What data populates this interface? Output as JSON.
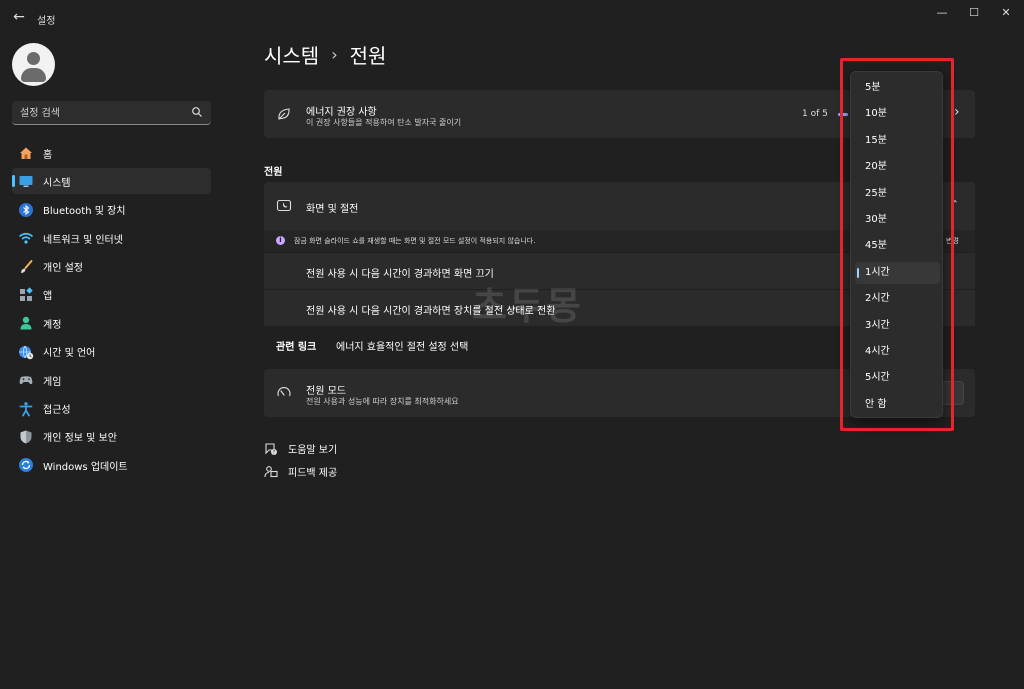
{
  "window": {
    "app_title": "설정",
    "back_glyph": "←",
    "minimize_glyph": "—",
    "maximize_glyph": "☐",
    "close_glyph": "✕"
  },
  "search": {
    "placeholder": "설정 검색",
    "icon": "search-icon"
  },
  "sidebar": {
    "items": [
      {
        "label": "홈",
        "icon": "home-icon"
      },
      {
        "label": "시스템",
        "icon": "monitor-icon",
        "active": true
      },
      {
        "label": "Bluetooth 및 장치",
        "icon": "bluetooth-icon"
      },
      {
        "label": "네트워크 및 인터넷",
        "icon": "wifi-icon"
      },
      {
        "label": "개인 설정",
        "icon": "paintbrush-icon"
      },
      {
        "label": "앱",
        "icon": "apps-icon"
      },
      {
        "label": "계정",
        "icon": "person-icon"
      },
      {
        "label": "시간 및 언어",
        "icon": "globe-clock-icon"
      },
      {
        "label": "게임",
        "icon": "gamepad-icon"
      },
      {
        "label": "접근성",
        "icon": "accessibility-icon"
      },
      {
        "label": "개인 정보 및 보안",
        "icon": "shield-icon"
      },
      {
        "label": "Windows 업데이트",
        "icon": "update-icon"
      }
    ]
  },
  "header": {
    "breadcrumb_parent": "시스템",
    "separator": "›",
    "breadcrumb_current": "전원"
  },
  "energy_card": {
    "title": "에너지 권장 사항",
    "subtitle": "이 권장 사항들을 적용하여 탄소 발자국 줄이기",
    "page_indicator": "1 of 5",
    "chevron": "›"
  },
  "section": {
    "label": "전원"
  },
  "screen_sleep": {
    "title": "화면 및 절전",
    "collapse_glyph": "ˆ",
    "info_text": "잠금 화면 슬라이드 쇼를 재생할 때는 화면 및 절전 모드 설정이 적용되지 않습니다.",
    "info_link_partial": "변경",
    "rows": [
      {
        "label": "전원 사용 시 다음 시간이 경과하면 화면 끄기"
      },
      {
        "label": "전원 사용 시 다음 시간이 경과하면 장치를 절전 상태로 전환"
      }
    ]
  },
  "related_links": {
    "title": "관련 링크",
    "link": "에너지 효율적인 절전 설정 선택"
  },
  "power_mode": {
    "title": "전원 모드",
    "subtitle": "전원 사용과 성능에 따라 장치를 최적화하세요"
  },
  "footer": {
    "help": "도움말 보기",
    "feedback": "피드백 제공"
  },
  "dropdown": {
    "options": [
      "5분",
      "10분",
      "15분",
      "20분",
      "25분",
      "30분",
      "45분",
      "1시간",
      "2시간",
      "3시간",
      "4시간",
      "5시간",
      "안 함"
    ],
    "selected": "1시간"
  },
  "watermark": {
    "text": "초두몽"
  },
  "colors": {
    "accent": "#4cc2ff",
    "highlight": "#e3262d",
    "background": "#202020",
    "card": "#2b2b2b"
  }
}
